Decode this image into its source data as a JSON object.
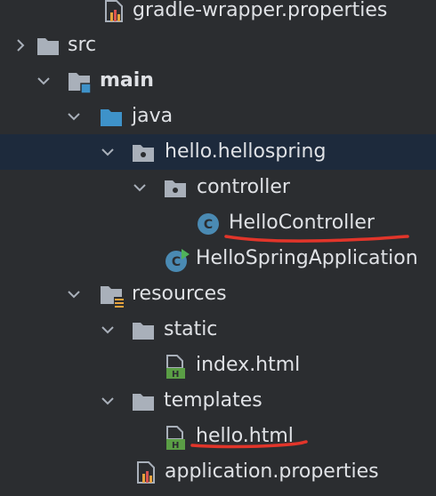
{
  "colors": {
    "background": "#2b2d30",
    "selected_row": "#1d2a3c",
    "text": "#dfe1e5",
    "folder": "#a9b0ba",
    "source_folder": "#3e92c9",
    "class_icon": "#4a8ab3",
    "html_icon": "#5a9e45",
    "annotation": "#e2352a"
  },
  "tree": {
    "gradle_wrapper_properties": {
      "label": "gradle-wrapper.properties",
      "icon": "properties-file-icon"
    },
    "src": {
      "label": "src",
      "icon": "folder-icon",
      "expanded": false
    },
    "main": {
      "label": "main",
      "icon": "module-folder-icon",
      "expanded": true
    },
    "java": {
      "label": "java",
      "icon": "source-folder-icon",
      "expanded": true
    },
    "package_hellospring": {
      "label": "hello.hellospring",
      "icon": "package-icon",
      "expanded": true,
      "selected": true
    },
    "package_controller": {
      "label": "controller",
      "icon": "package-icon",
      "expanded": true
    },
    "hello_controller": {
      "label": "HelloController",
      "icon": "class-icon"
    },
    "hello_spring_application": {
      "label": "HelloSpringApplication",
      "icon": "spring-app-class-icon"
    },
    "resources": {
      "label": "resources",
      "icon": "resources-folder-icon",
      "expanded": true
    },
    "static": {
      "label": "static",
      "icon": "folder-icon",
      "expanded": true
    },
    "index_html": {
      "label": "index.html",
      "icon": "html-file-icon"
    },
    "templates": {
      "label": "templates",
      "icon": "folder-icon",
      "expanded": true
    },
    "hello_html": {
      "label": "hello.html",
      "icon": "html-file-icon"
    },
    "application_properties": {
      "label": "application.properties",
      "icon": "properties-file-icon"
    }
  },
  "class_icon_letter": "C",
  "html_icon_letter": "H"
}
